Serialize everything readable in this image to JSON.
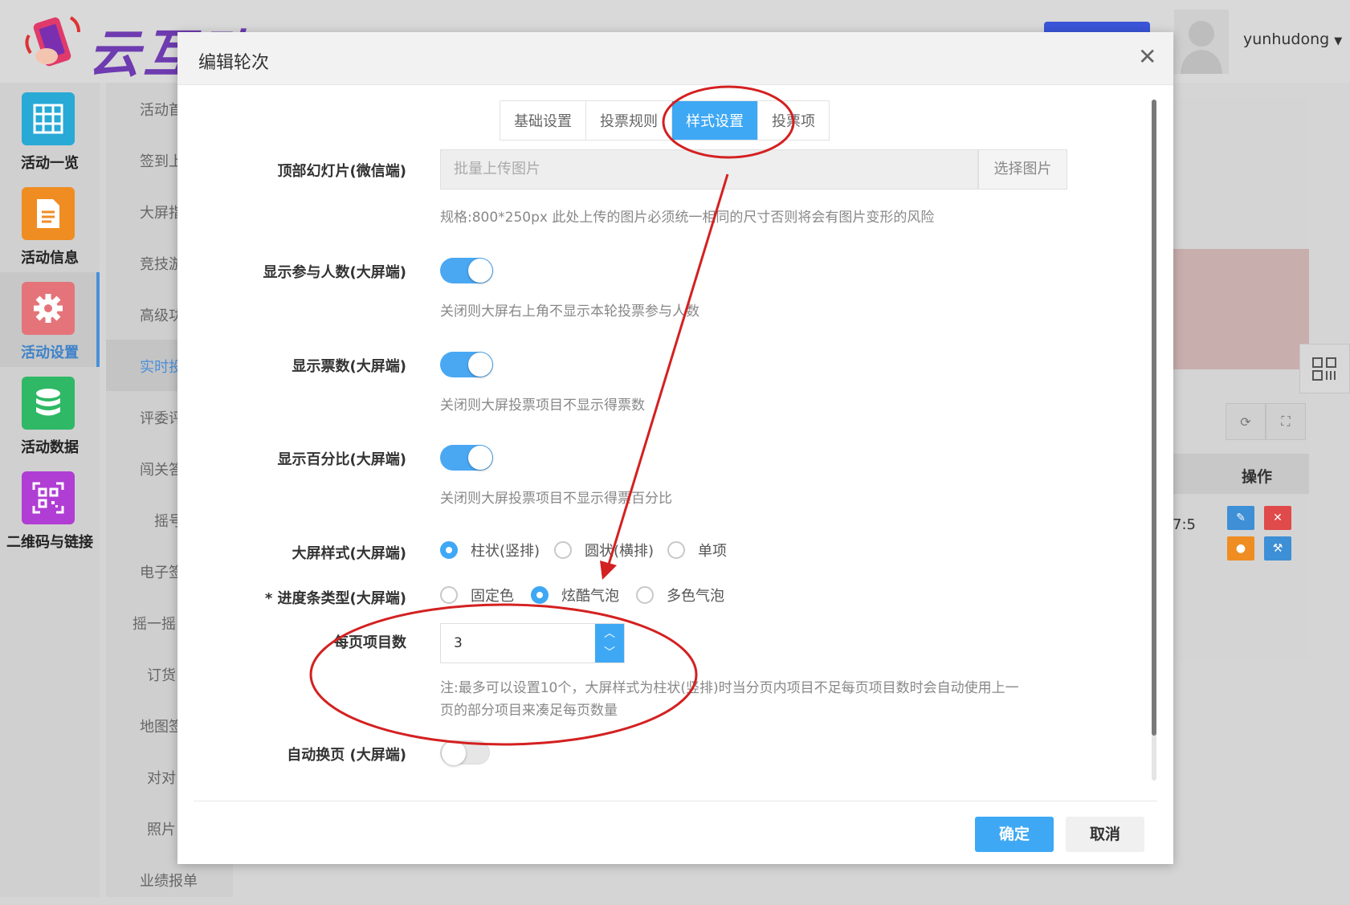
{
  "app": {
    "logo_text": "云互动",
    "username": "yunhudong"
  },
  "leftnav": {
    "items": [
      {
        "label": "活动一览",
        "icon": "grid-icon",
        "color": "#28a9d6"
      },
      {
        "label": "活动信息",
        "icon": "document-icon",
        "color": "#ef8d22"
      },
      {
        "label": "活动设置",
        "icon": "gear-icon",
        "color": "#e5747a"
      },
      {
        "label": "活动数据",
        "icon": "database-icon",
        "color": "#2fb865"
      },
      {
        "label": "二维码与链接",
        "icon": "qrcode-icon",
        "color": "#b03dd4"
      }
    ]
  },
  "subnav": {
    "items": [
      "活动首",
      "签到上",
      "大屏指",
      "竞技游",
      "高级功",
      "实时投",
      "评委评",
      "闯关答",
      "摇号",
      "电子签",
      "摇一摇",
      "订货",
      "地图签",
      "对对",
      "照片",
      "业绩报单"
    ]
  },
  "background": {
    "ops_header": "操作",
    "row_value": "7:5"
  },
  "modal": {
    "title": "编辑轮次",
    "tabs": [
      "基础设置",
      "投票规则",
      "样式设置",
      "投票项"
    ],
    "active_tab": "样式设置",
    "fields": {
      "slideshow": {
        "label": "顶部幻灯片(微信端)",
        "placeholder": "批量上传图片",
        "button": "选择图片",
        "hint": "规格:800*250px 此处上传的图片必须统一相同的尺寸否则将会有图片变形的风险"
      },
      "show_participants": {
        "label": "显示参与人数(大屏端)",
        "on": true,
        "hint": "关闭则大屏右上角不显示本轮投票参与人数"
      },
      "show_votes": {
        "label": "显示票数(大屏端)",
        "on": true,
        "hint": "关闭则大屏投票项目不显示得票数"
      },
      "show_percent": {
        "label": "显示百分比(大屏端)",
        "on": true,
        "hint": "关闭则大屏投票项目不显示得票百分比"
      },
      "screen_style": {
        "label": "大屏样式(大屏端)",
        "options": [
          "柱状(竖排)",
          "圆状(横排)",
          "单项"
        ],
        "selected": 0
      },
      "progress_type": {
        "label": "* 进度条类型(大屏端)",
        "options": [
          "固定色",
          "炫酷气泡",
          "多色气泡"
        ],
        "selected": 1
      },
      "items_per_page": {
        "label": "每页项目数",
        "value": "3",
        "hint_line1": "注:最多可以设置10个，大屏样式为柱状(竖排)时当分页内项目不足每页项目数时会自动使用上一",
        "hint_line2": "页的部分项目来凑足每页数量"
      },
      "auto_page": {
        "label": "自动换页 (大屏端)",
        "on": false
      }
    },
    "ok_button": "确定",
    "cancel_button": "取消"
  },
  "colors": {
    "accent": "#3ea8f5",
    "annotation": "#d42020"
  }
}
